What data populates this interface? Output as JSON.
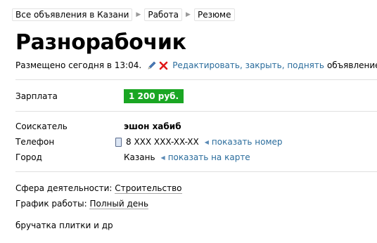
{
  "breadcrumb": {
    "items": [
      "Все объявления в Казани",
      "Работа",
      "Резюме"
    ],
    "separator": "▶"
  },
  "ad": {
    "title": "Разнорабочик",
    "posted": "Размещено сегодня в 13:04.",
    "edit_link": "Редактировать, закрыть, поднять",
    "edit_suffix": "объявление"
  },
  "salary": {
    "label": "Зарплата",
    "value": "1 200 руб."
  },
  "applicant": {
    "label": "Соискатель",
    "value": "эшон хабиб"
  },
  "phone": {
    "label": "Телефон",
    "value": "8 XXX XXX-XX-XX",
    "link": "показать номер"
  },
  "city": {
    "label": "Город",
    "value": "Казань",
    "link": "показать на карте"
  },
  "field": {
    "label": "Сфера деятельности:",
    "value": "Строительство"
  },
  "schedule": {
    "label": "График работы:",
    "value": "Полный день"
  },
  "description": "бручатка плитки и др",
  "colors": {
    "link": "#2a6c9c",
    "salary_bg": "#1aa623",
    "delete_red": "#e01818"
  },
  "icons": [
    "pencil-icon",
    "delete-x-icon",
    "phone-icon",
    "triangle-left-icon"
  ]
}
